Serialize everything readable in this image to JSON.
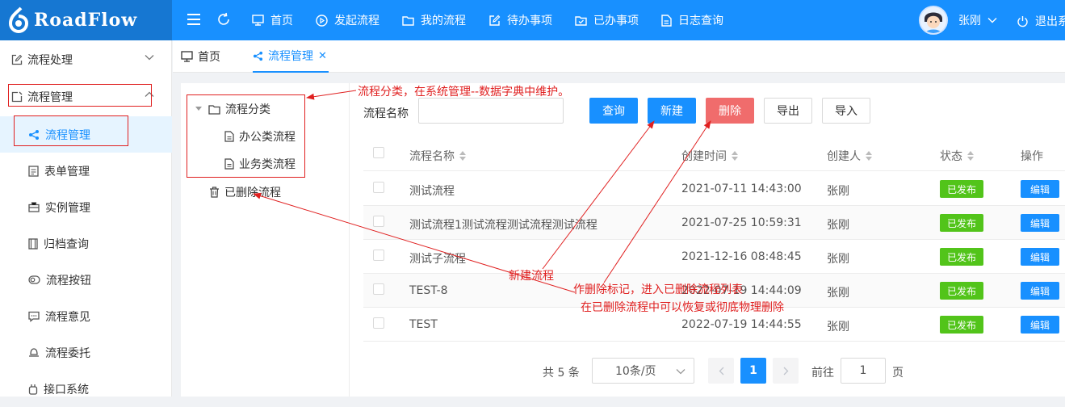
{
  "header": {
    "logo_text": "RoadFlow",
    "nav": [
      "首页",
      "发起流程",
      "我的流程",
      "待办事项",
      "已办事项",
      "日志查询"
    ],
    "user_name": "张刚",
    "logout_label": "退出系"
  },
  "sidebar": {
    "groups": [
      {
        "label": "流程处理"
      },
      {
        "label": "流程管理"
      }
    ],
    "items": [
      {
        "label": "流程管理",
        "icon": "share-icon",
        "active": true
      },
      {
        "label": "表单管理",
        "icon": "form-icon"
      },
      {
        "label": "实例管理",
        "icon": "briefcase-icon"
      },
      {
        "label": "归档查询",
        "icon": "archive-icon"
      },
      {
        "label": "流程按钮",
        "icon": "toggle-icon"
      },
      {
        "label": "流程意见",
        "icon": "comment-icon"
      },
      {
        "label": "流程委托",
        "icon": "bell-icon"
      },
      {
        "label": "接口系统",
        "icon": "api-icon"
      }
    ]
  },
  "tabs": [
    {
      "label": "首页",
      "icon": "monitor-icon"
    },
    {
      "label": "流程管理",
      "icon": "share-icon",
      "active": true,
      "close": "✕"
    }
  ],
  "tree": {
    "root": "流程分类",
    "children": [
      "办公类流程",
      "业务类流程"
    ],
    "deleted": "已删除流程"
  },
  "query": {
    "label": "流程名称",
    "input_value": "",
    "buttons": {
      "search": "查询",
      "new": "新建",
      "delete": "删除",
      "export": "导出",
      "import": "导入"
    }
  },
  "table": {
    "columns": [
      "流程名称",
      "创建时间",
      "创建人",
      "状态",
      "操作"
    ],
    "rows": [
      {
        "name": "测试流程",
        "time": "2021-07-11 14:43:00",
        "creator": "张刚",
        "status": "已发布",
        "action": "编辑"
      },
      {
        "name": "测试流程1测试流程测试流程测试流程",
        "time": "2021-07-25 10:59:31",
        "creator": "张刚",
        "status": "已发布",
        "action": "编辑"
      },
      {
        "name": "测试子流程",
        "time": "2021-12-16 08:48:45",
        "creator": "张刚",
        "status": "已发布",
        "action": "编辑"
      },
      {
        "name": "TEST-8",
        "time": "2022-07-19 14:44:09",
        "creator": "张刚",
        "status": "已发布",
        "action": "编辑"
      },
      {
        "name": "TEST",
        "time": "2022-07-19 14:44:55",
        "creator": "张刚",
        "status": "已发布",
        "action": "编辑"
      }
    ]
  },
  "pagination": {
    "total": "共 5 条",
    "page_size": "10条/页",
    "current": "1",
    "goto_label": "前往",
    "goto_value": "1",
    "page_suffix": "页"
  },
  "annotations": {
    "category": "流程分类，在系统管理--数据字典中维护。",
    "new_flow": "新建流程",
    "delete_line1": "作删除标记，进入已删除流程列表",
    "delete_line2": "在已删除流程中可以恢复或彻底物理删除"
  },
  "colors": {
    "primary": "#1890ff",
    "danger": "#f06c6c",
    "success": "#52c41a",
    "annotation": "#e02020"
  }
}
